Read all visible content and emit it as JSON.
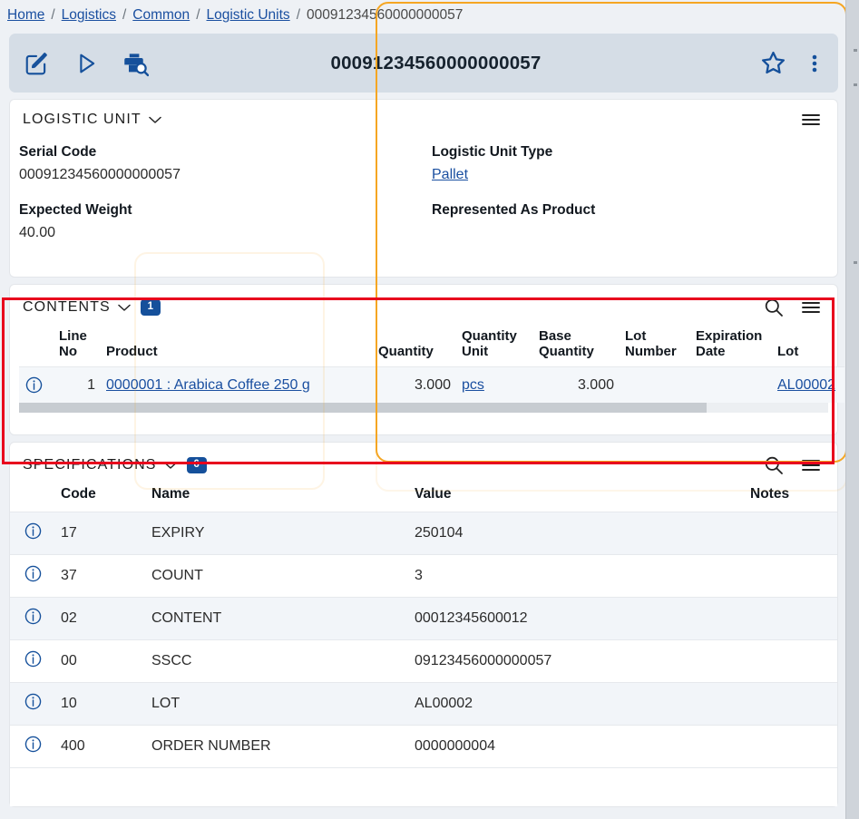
{
  "breadcrumb": {
    "items": [
      {
        "label": "Home",
        "link": true
      },
      {
        "label": "Logistics",
        "link": true
      },
      {
        "label": "Common",
        "link": true
      },
      {
        "label": "Logistic Units",
        "link": true
      },
      {
        "label": "00091234560000000057",
        "link": false
      }
    ],
    "separator": "/"
  },
  "object_header": {
    "title": "00091234560000000057",
    "tools": [
      {
        "name": "edit-icon",
        "label": "Edit"
      },
      {
        "name": "run-icon",
        "label": "Run"
      },
      {
        "name": "print-search-icon",
        "label": "Print and Search"
      }
    ],
    "right_tools": [
      {
        "name": "favorite-star-icon",
        "label": "Add to favorites"
      },
      {
        "name": "overflow-menu-icon",
        "label": "More options"
      }
    ],
    "accent_color": "#15509b",
    "bar_color": "#d5dde6"
  },
  "logistic_unit": {
    "title": "LOGISTIC UNIT",
    "collapse_chevron": "⌄",
    "menu_icon": "hamburger-icon",
    "fields": [
      {
        "label": "Serial Code",
        "value": "00091234560000000057",
        "link": false
      },
      {
        "label": "Logistic Unit Type",
        "value": "Pallet",
        "link": true
      },
      {
        "label": "Expected Weight",
        "value": "40.00",
        "link": false
      },
      {
        "label": "Represented As Product",
        "value": "",
        "link": false
      }
    ]
  },
  "contents": {
    "title": "CONTENTS",
    "count_badge": "1",
    "collapse_chevron": "⌄",
    "search_icon": "search-icon",
    "menu_icon": "hamburger-icon",
    "columns": [
      {
        "key": "info",
        "label": ""
      },
      {
        "key": "line_no",
        "label": "Line No",
        "align": "right"
      },
      {
        "key": "product",
        "label": "Product",
        "align": "left"
      },
      {
        "key": "quantity",
        "label": "Quantity",
        "align": "right"
      },
      {
        "key": "quantity_unit",
        "label": "Quantity Unit",
        "align": "left"
      },
      {
        "key": "base_quantity",
        "label": "Base Quantity",
        "align": "right"
      },
      {
        "key": "lot_number",
        "label": "Lot Number",
        "align": "left"
      },
      {
        "key": "expiration_date",
        "label": "Expiration Date",
        "align": "left"
      },
      {
        "key": "lot",
        "label": "Lot",
        "align": "left"
      }
    ],
    "rows": [
      {
        "line_no": "1",
        "product": "0000001 : Arabica Coffee 250 g",
        "product_link": true,
        "quantity": "3.000",
        "quantity_unit": "pcs",
        "quantity_unit_link": true,
        "base_quantity": "3.000",
        "lot_number": "",
        "expiration_date": "",
        "lot": "AL00002",
        "lot_link": true
      }
    ]
  },
  "specifications": {
    "title": "SPECIFICATIONS",
    "count_badge": "6",
    "collapse_chevron": "⌄",
    "search_icon": "search-icon",
    "menu_icon": "hamburger-icon",
    "columns": [
      {
        "key": "info",
        "label": ""
      },
      {
        "key": "code",
        "label": "Code"
      },
      {
        "key": "name",
        "label": "Name"
      },
      {
        "key": "value",
        "label": "Value"
      },
      {
        "key": "notes",
        "label": "Notes"
      }
    ],
    "rows": [
      {
        "code": "17",
        "name": "EXPIRY",
        "value": "250104",
        "notes": ""
      },
      {
        "code": "37",
        "name": "COUNT",
        "value": "3",
        "notes": ""
      },
      {
        "code": "02",
        "name": "CONTENT",
        "value": "00012345600012",
        "notes": ""
      },
      {
        "code": "00",
        "name": "SSCC",
        "value": "09123456000000057",
        "notes": ""
      },
      {
        "code": "10",
        "name": "LOT",
        "value": "AL00002",
        "notes": ""
      },
      {
        "code": "400",
        "name": "ORDER NUMBER",
        "value": "0000000004",
        "notes": ""
      }
    ]
  },
  "highlights": {
    "focus_outline_color": "#f5a623",
    "annotation_box_color": "#e8001d"
  },
  "scrollbar": {
    "orientation": "vertical",
    "track_color": "#cfd4da"
  }
}
